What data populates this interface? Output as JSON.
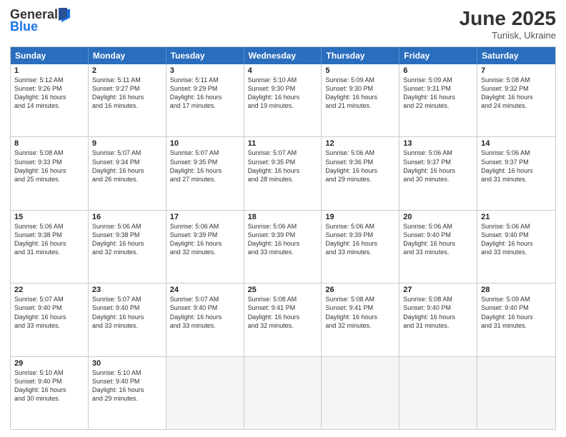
{
  "logo": {
    "general": "General",
    "blue": "Blue"
  },
  "title": "June 2025",
  "subtitle": "Turiisk, Ukraine",
  "header_days": [
    "Sunday",
    "Monday",
    "Tuesday",
    "Wednesday",
    "Thursday",
    "Friday",
    "Saturday"
  ],
  "rows": [
    [
      {
        "day": "1",
        "lines": [
          "Sunrise: 5:12 AM",
          "Sunset: 9:26 PM",
          "Daylight: 16 hours",
          "and 14 minutes."
        ]
      },
      {
        "day": "2",
        "lines": [
          "Sunrise: 5:11 AM",
          "Sunset: 9:27 PM",
          "Daylight: 16 hours",
          "and 16 minutes."
        ]
      },
      {
        "day": "3",
        "lines": [
          "Sunrise: 5:11 AM",
          "Sunset: 9:29 PM",
          "Daylight: 16 hours",
          "and 17 minutes."
        ]
      },
      {
        "day": "4",
        "lines": [
          "Sunrise: 5:10 AM",
          "Sunset: 9:30 PM",
          "Daylight: 16 hours",
          "and 19 minutes."
        ]
      },
      {
        "day": "5",
        "lines": [
          "Sunrise: 5:09 AM",
          "Sunset: 9:30 PM",
          "Daylight: 16 hours",
          "and 21 minutes."
        ]
      },
      {
        "day": "6",
        "lines": [
          "Sunrise: 5:09 AM",
          "Sunset: 9:31 PM",
          "Daylight: 16 hours",
          "and 22 minutes."
        ]
      },
      {
        "day": "7",
        "lines": [
          "Sunrise: 5:08 AM",
          "Sunset: 9:32 PM",
          "Daylight: 16 hours",
          "and 24 minutes."
        ]
      }
    ],
    [
      {
        "day": "8",
        "lines": [
          "Sunrise: 5:08 AM",
          "Sunset: 9:33 PM",
          "Daylight: 16 hours",
          "and 25 minutes."
        ]
      },
      {
        "day": "9",
        "lines": [
          "Sunrise: 5:07 AM",
          "Sunset: 9:34 PM",
          "Daylight: 16 hours",
          "and 26 minutes."
        ]
      },
      {
        "day": "10",
        "lines": [
          "Sunrise: 5:07 AM",
          "Sunset: 9:35 PM",
          "Daylight: 16 hours",
          "and 27 minutes."
        ]
      },
      {
        "day": "11",
        "lines": [
          "Sunrise: 5:07 AM",
          "Sunset: 9:35 PM",
          "Daylight: 16 hours",
          "and 28 minutes."
        ]
      },
      {
        "day": "12",
        "lines": [
          "Sunrise: 5:06 AM",
          "Sunset: 9:36 PM",
          "Daylight: 16 hours",
          "and 29 minutes."
        ]
      },
      {
        "day": "13",
        "lines": [
          "Sunrise: 5:06 AM",
          "Sunset: 9:37 PM",
          "Daylight: 16 hours",
          "and 30 minutes."
        ]
      },
      {
        "day": "14",
        "lines": [
          "Sunrise: 5:06 AM",
          "Sunset: 9:37 PM",
          "Daylight: 16 hours",
          "and 31 minutes."
        ]
      }
    ],
    [
      {
        "day": "15",
        "lines": [
          "Sunrise: 5:06 AM",
          "Sunset: 9:38 PM",
          "Daylight: 16 hours",
          "and 31 minutes."
        ]
      },
      {
        "day": "16",
        "lines": [
          "Sunrise: 5:06 AM",
          "Sunset: 9:38 PM",
          "Daylight: 16 hours",
          "and 32 minutes."
        ]
      },
      {
        "day": "17",
        "lines": [
          "Sunrise: 5:06 AM",
          "Sunset: 9:39 PM",
          "Daylight: 16 hours",
          "and 32 minutes."
        ]
      },
      {
        "day": "18",
        "lines": [
          "Sunrise: 5:06 AM",
          "Sunset: 9:39 PM",
          "Daylight: 16 hours",
          "and 33 minutes."
        ]
      },
      {
        "day": "19",
        "lines": [
          "Sunrise: 5:06 AM",
          "Sunset: 9:39 PM",
          "Daylight: 16 hours",
          "and 33 minutes."
        ]
      },
      {
        "day": "20",
        "lines": [
          "Sunrise: 5:06 AM",
          "Sunset: 9:40 PM",
          "Daylight: 16 hours",
          "and 33 minutes."
        ]
      },
      {
        "day": "21",
        "lines": [
          "Sunrise: 5:06 AM",
          "Sunset: 9:40 PM",
          "Daylight: 16 hours",
          "and 33 minutes."
        ]
      }
    ],
    [
      {
        "day": "22",
        "lines": [
          "Sunrise: 5:07 AM",
          "Sunset: 9:40 PM",
          "Daylight: 16 hours",
          "and 33 minutes."
        ]
      },
      {
        "day": "23",
        "lines": [
          "Sunrise: 5:07 AM",
          "Sunset: 9:40 PM",
          "Daylight: 16 hours",
          "and 33 minutes."
        ]
      },
      {
        "day": "24",
        "lines": [
          "Sunrise: 5:07 AM",
          "Sunset: 9:40 PM",
          "Daylight: 16 hours",
          "and 33 minutes."
        ]
      },
      {
        "day": "25",
        "lines": [
          "Sunrise: 5:08 AM",
          "Sunset: 9:41 PM",
          "Daylight: 16 hours",
          "and 32 minutes."
        ]
      },
      {
        "day": "26",
        "lines": [
          "Sunrise: 5:08 AM",
          "Sunset: 9:41 PM",
          "Daylight: 16 hours",
          "and 32 minutes."
        ]
      },
      {
        "day": "27",
        "lines": [
          "Sunrise: 5:08 AM",
          "Sunset: 9:40 PM",
          "Daylight: 16 hours",
          "and 31 minutes."
        ]
      },
      {
        "day": "28",
        "lines": [
          "Sunrise: 5:09 AM",
          "Sunset: 9:40 PM",
          "Daylight: 16 hours",
          "and 31 minutes."
        ]
      }
    ],
    [
      {
        "day": "29",
        "lines": [
          "Sunrise: 5:10 AM",
          "Sunset: 9:40 PM",
          "Daylight: 16 hours",
          "and 30 minutes."
        ]
      },
      {
        "day": "30",
        "lines": [
          "Sunrise: 5:10 AM",
          "Sunset: 9:40 PM",
          "Daylight: 16 hours",
          "and 29 minutes."
        ]
      },
      {
        "day": "",
        "lines": []
      },
      {
        "day": "",
        "lines": []
      },
      {
        "day": "",
        "lines": []
      },
      {
        "day": "",
        "lines": []
      },
      {
        "day": "",
        "lines": []
      }
    ]
  ]
}
